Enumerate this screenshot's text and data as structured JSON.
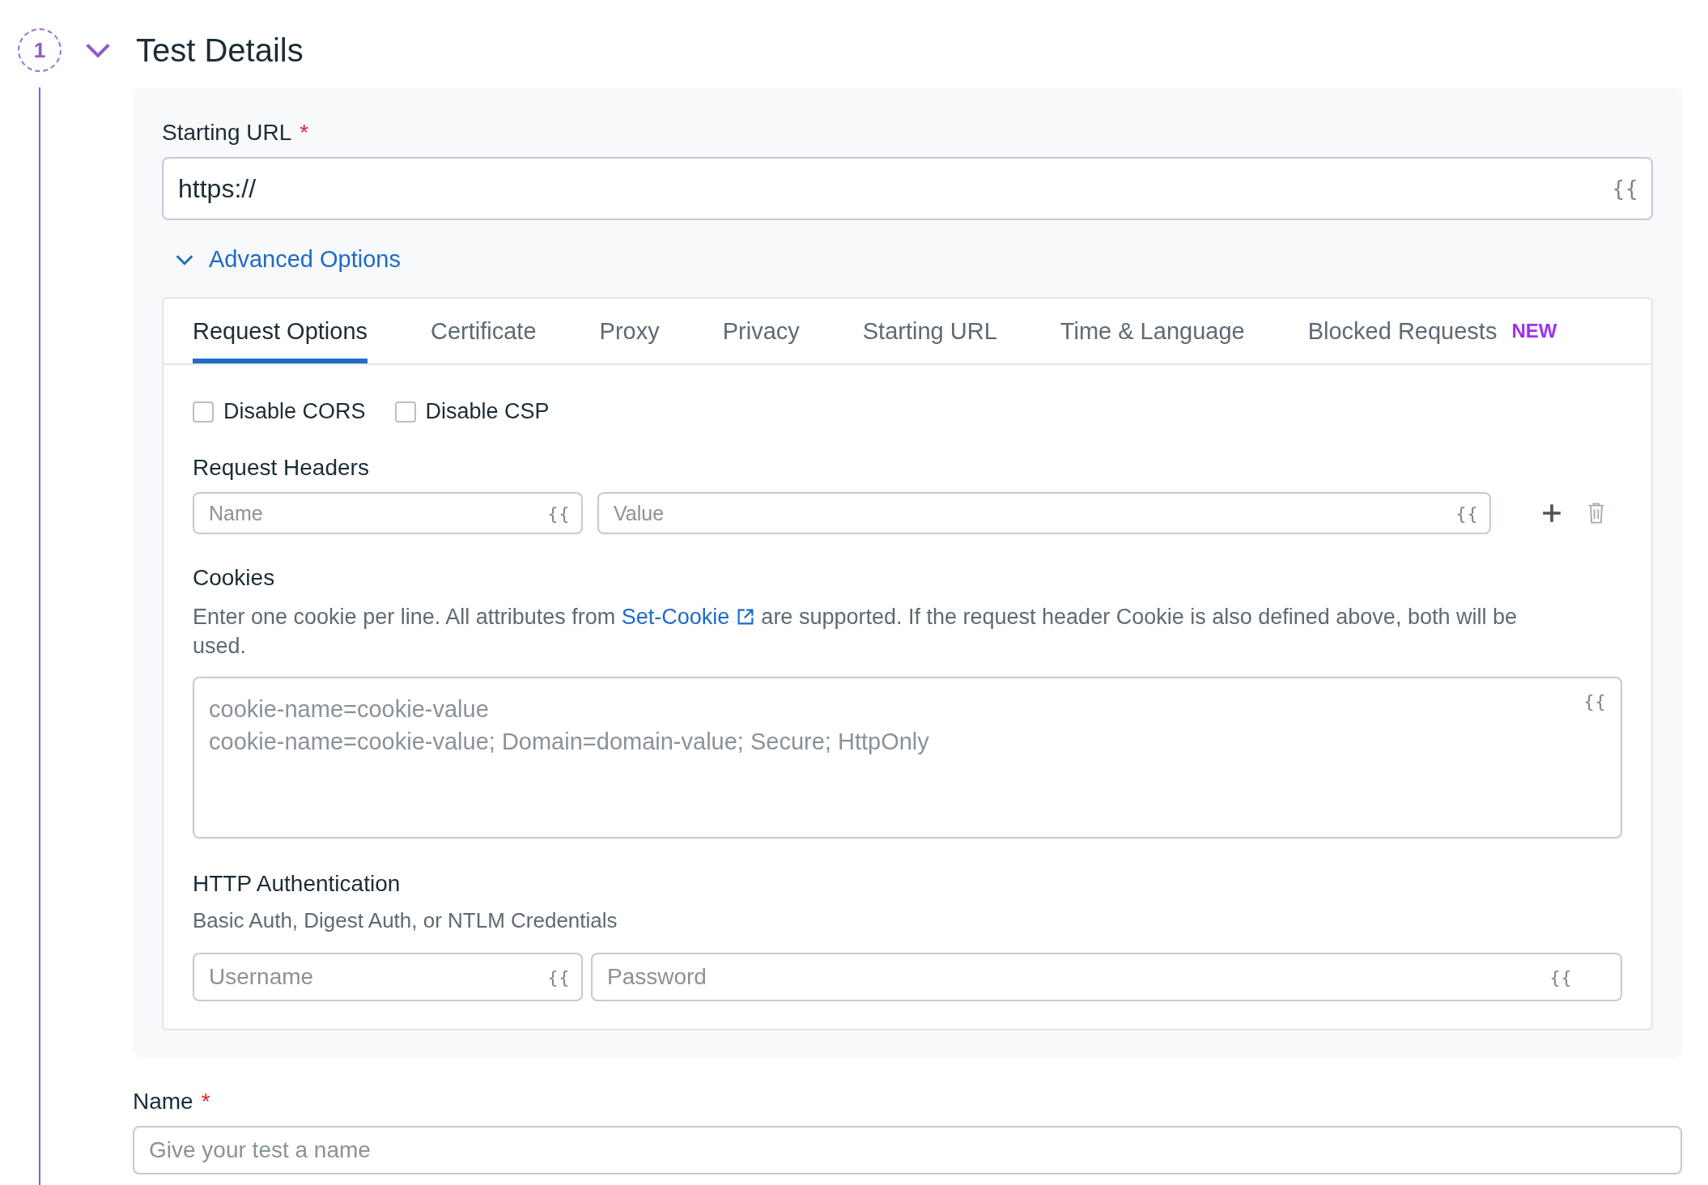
{
  "step": {
    "number": "1",
    "title": "Test Details",
    "expanded": true
  },
  "starting_url": {
    "label": "Starting URL",
    "required_mark": "*",
    "value": "https://",
    "variable_button": "{{"
  },
  "advanced_options": {
    "label": "Advanced Options",
    "expanded": true
  },
  "tabs": [
    {
      "label": "Request Options",
      "selected": true
    },
    {
      "label": "Certificate",
      "selected": false
    },
    {
      "label": "Proxy",
      "selected": false
    },
    {
      "label": "Privacy",
      "selected": false
    },
    {
      "label": "Starting URL",
      "selected": false
    },
    {
      "label": "Time & Language",
      "selected": false
    },
    {
      "label": "Blocked Requests",
      "selected": false,
      "badge": "NEW"
    }
  ],
  "checkboxes": [
    {
      "label": "Disable CORS",
      "checked": false
    },
    {
      "label": "Disable CSP",
      "checked": false
    }
  ],
  "request_headers": {
    "label": "Request Headers",
    "name_placeholder": "Name",
    "name_variable_button": "{{",
    "value_placeholder": "Value",
    "value_variable_button": "{{"
  },
  "cookies": {
    "label": "Cookies",
    "description_before": "Enter one cookie per line. All attributes from",
    "link": "Set-Cookie",
    "description_after": "are supported. If the request header Cookie is also defined above, both will be used.",
    "placeholder_lines": [
      "cookie-name=cookie-value",
      "cookie-name=cookie-value; Domain=domain-value; Secure; HttpOnly"
    ],
    "variable_button": "{{"
  },
  "http_auth": {
    "label": "HTTP Authentication",
    "description": "Basic Auth, Digest Auth, or NTLM Credentials",
    "username_placeholder": "Username",
    "username_variable_button": "{{",
    "password_placeholder": "Password",
    "password_variable_button": "{{"
  },
  "name": {
    "label": "Name",
    "required_mark": "*",
    "placeholder": "Give your test a name"
  }
}
